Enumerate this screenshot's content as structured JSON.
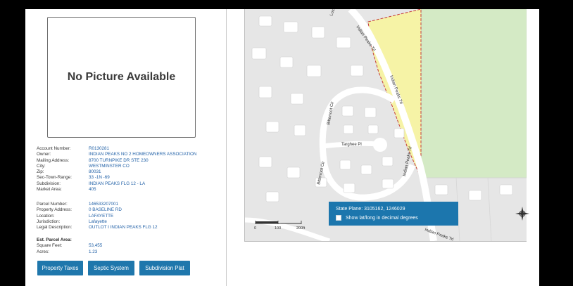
{
  "photo": {
    "text": "No Picture Available"
  },
  "account": [
    {
      "label": "Account Number:",
      "value": "R0130281"
    },
    {
      "label": "Owner:",
      "value": "INDIAN PEAKS NO 2 HOMEOWNERS ASSOCIATION"
    },
    {
      "label": "Mailing Address:",
      "value": "8700 TURNPIKE DR STE 230"
    },
    {
      "label": "City:",
      "value": "WESTMINSTER  CO"
    },
    {
      "label": "Zip:",
      "value": "80031"
    },
    {
      "label": "Sec-Town-Range:",
      "value": "33 -1N -69"
    },
    {
      "label": "Subdivision:",
      "value": "INDIAN PEAKS FLG 12 - LA"
    },
    {
      "label": "Market Area:",
      "value": "405"
    }
  ],
  "parcel": [
    {
      "label": "Parcel Number:",
      "value": "146533207001"
    },
    {
      "label": "Property Address:",
      "value": "0 BASELINE RD"
    },
    {
      "label": "Location:",
      "value": "LAFAYETTE"
    },
    {
      "label": "Jurisdiction:",
      "value": "Lafayette"
    },
    {
      "label": "Legal Description:",
      "value": "OUTLOT I INDIAN PEAKS FLG 12"
    }
  ],
  "area": {
    "heading": "Est. Parcel Area:",
    "rows": [
      {
        "label": "Square Feet:",
        "value": "53,455"
      },
      {
        "label": "Acres:",
        "value": "1.23"
      }
    ]
  },
  "buttons": {
    "property_taxes": "Property Taxes",
    "septic_system": "Septic System",
    "subdivision_plat": "Subdivision Plat"
  },
  "map": {
    "streets": {
      "lost": "Lost",
      "indian_peaks_tr_1": "Indian Peaks Trl",
      "indian_peaks_tr_2": "Indian Peaks Trl",
      "indian_peaks_tr_3": "Indian Peaks Trl",
      "indian_peaks_tr_4": "Indian Peaks Trl",
      "bitterroot_1": "Bitterroot Cir",
      "bitterroot_2": "Bitterroot Cir",
      "targhee": "Targhee Pl"
    },
    "scale": {
      "t0": "0",
      "t1": "100",
      "t2": "200ft"
    },
    "popup": {
      "state_plane": "State Plane: 3105162, 1246029",
      "checkbox_label": "Show lat/long in decimal degrees"
    },
    "colors": {
      "parcel": "#f6f3a6",
      "open_space": "#d4eac5",
      "boundary": "#c43a3a",
      "road": "#ffffff"
    }
  }
}
